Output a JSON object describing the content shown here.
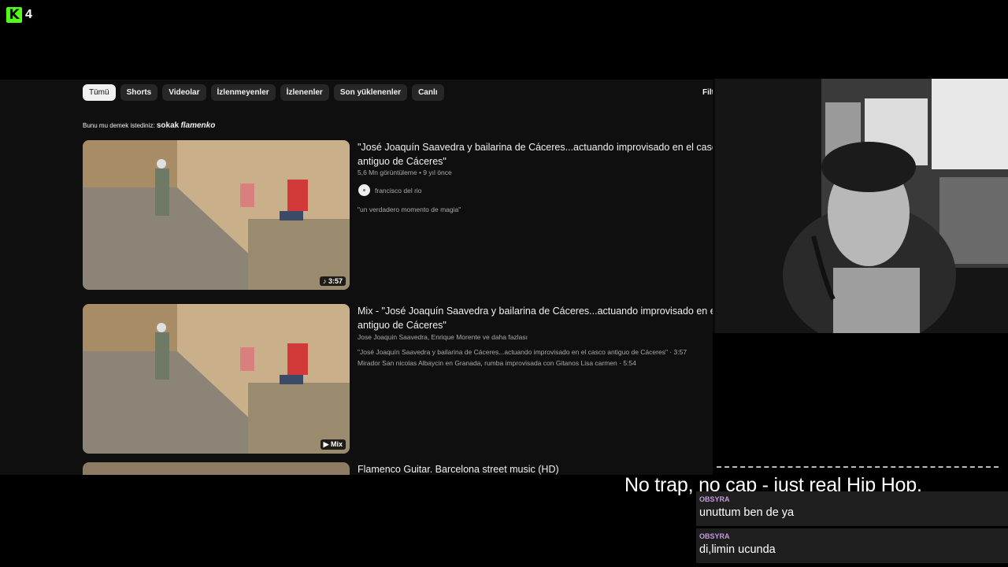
{
  "stream": {
    "logo_letter": "K",
    "viewer_count": "4"
  },
  "youtube": {
    "chips": [
      "Tümü",
      "Shorts",
      "Videolar",
      "İzlenmeyenler",
      "İzlenenler",
      "Son yüklenenler",
      "Canlı"
    ],
    "filter_label": "Filt",
    "suggestion": {
      "prefix": "Bunu mu demek istediniz:",
      "bold": "sokak",
      "italic": "flamenko"
    },
    "videos": [
      {
        "title_line1": "\"José Joaquín Saavedra y bailarina de Cáceres...actuando improvisado en el casco",
        "title_line2": "antiguo de Cáceres\"",
        "meta": "5,6 Mn görüntüleme • 9 yıl önce",
        "channel": "francisco del rio",
        "description": "\"un verdadero momento de magia\"",
        "badge": "♪ 3:57"
      },
      {
        "title_line1": "Mix - \"José Joaquín Saavedra y bailarina de Cáceres...actuando improvisado en el c",
        "title_line2": "antiguo de Cáceres\"",
        "meta": "Jose Joaquin Saavedra, Enrique Morente ve daha fazlası",
        "track1": "\"José Joaquín Saavedra y bailarina de Cáceres...actuando improvisado en el casco antiguo de Cáceres\" · 3:57",
        "track2": "Mirador San nicolas Albaycin en Granada, rumba improvisada con Gitanos Lisa carmen · 5:54",
        "badge": "▶ Mix"
      },
      {
        "title_line1": "Flamenco Guitar. Barcelona street music (HD)"
      }
    ]
  },
  "caption": "No trap, no cap - just real Hip Hop.",
  "chat": [
    {
      "user": "OBSYRA",
      "text": "unuttum ben de ya"
    },
    {
      "user": "OBSYRA",
      "text": "di,limin ucunda"
    }
  ],
  "colors": {
    "kick_green": "#53fc18",
    "chat_user": "#c49bd9",
    "yt_bg": "#0f0f0f"
  }
}
